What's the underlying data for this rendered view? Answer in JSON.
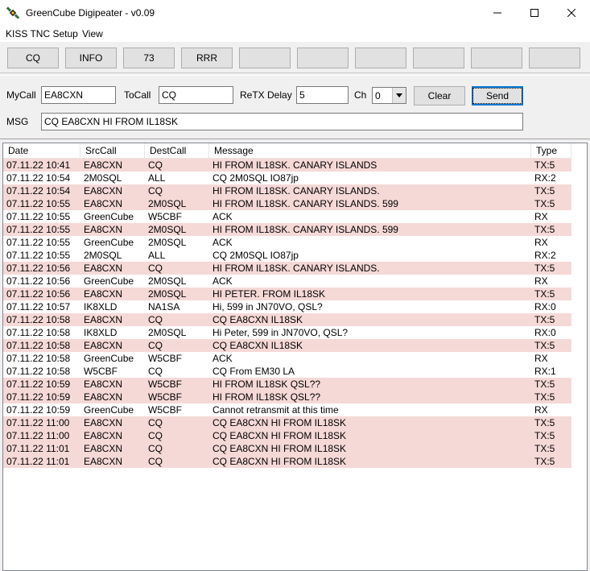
{
  "window": {
    "title": "GreenCube Digipeater - v0.09",
    "icon": "satellite-icon"
  },
  "menu": {
    "items": [
      {
        "label": "KISS TNC Setup"
      },
      {
        "label": "View"
      }
    ]
  },
  "quick_buttons": [
    {
      "label": "CQ"
    },
    {
      "label": "INFO"
    },
    {
      "label": "73"
    },
    {
      "label": "RRR"
    },
    {
      "label": ""
    },
    {
      "label": ""
    },
    {
      "label": ""
    },
    {
      "label": ""
    },
    {
      "label": ""
    },
    {
      "label": ""
    }
  ],
  "form": {
    "mycall_label": "MyCall",
    "mycall_value": "EA8CXN",
    "tocall_label": "ToCall",
    "tocall_value": "CQ",
    "retx_label": "ReTX Delay",
    "retx_value": "5",
    "ch_label": "Ch",
    "ch_value": "0",
    "clear_label": "Clear",
    "send_label": "Send",
    "msg_label": "MSG",
    "msg_value": "CQ EA8CXN HI FROM IL18SK"
  },
  "table": {
    "columns": [
      "Date",
      "SrcCall",
      "DestCall",
      "Message",
      "Type"
    ],
    "rows": [
      {
        "date": "07.11.22 10:41",
        "src": "EA8CXN",
        "dest": "CQ",
        "msg": "HI FROM IL18SK. CANARY ISLANDS",
        "type": "TX:5",
        "tx": true
      },
      {
        "date": "07.11.22 10:54",
        "src": "2M0SQL",
        "dest": "ALL",
        "msg": "CQ 2M0SQL IO87jp",
        "type": "RX:2",
        "tx": false
      },
      {
        "date": "07.11.22 10:54",
        "src": "EA8CXN",
        "dest": "CQ",
        "msg": "HI FROM IL18SK. CANARY ISLANDS.",
        "type": "TX:5",
        "tx": true
      },
      {
        "date": "07.11.22 10:55",
        "src": "EA8CXN",
        "dest": "2M0SQL",
        "msg": "HI FROM IL18SK. CANARY ISLANDS. 599",
        "type": "TX:5",
        "tx": true
      },
      {
        "date": "07.11.22 10:55",
        "src": "GreenCube",
        "dest": "W5CBF",
        "msg": "ACK",
        "type": "RX",
        "tx": false
      },
      {
        "date": "07.11.22 10:55",
        "src": "EA8CXN",
        "dest": "2M0SQL",
        "msg": "HI FROM IL18SK. CANARY ISLANDS. 599",
        "type": "TX:5",
        "tx": true
      },
      {
        "date": "07.11.22 10:55",
        "src": "GreenCube",
        "dest": "2M0SQL",
        "msg": "ACK",
        "type": "RX",
        "tx": false
      },
      {
        "date": "07.11.22 10:55",
        "src": "2M0SQL",
        "dest": "ALL",
        "msg": "CQ 2M0SQL IO87jp",
        "type": "RX:2",
        "tx": false
      },
      {
        "date": "07.11.22 10:56",
        "src": "EA8CXN",
        "dest": "CQ",
        "msg": "HI FROM IL18SK. CANARY ISLANDS.",
        "type": "TX:5",
        "tx": true
      },
      {
        "date": "07.11.22 10:56",
        "src": "GreenCube",
        "dest": "2M0SQL",
        "msg": "ACK",
        "type": "RX",
        "tx": false
      },
      {
        "date": "07.11.22 10:56",
        "src": "EA8CXN",
        "dest": "2M0SQL",
        "msg": "HI PETER. FROM IL18SK",
        "type": "TX:5",
        "tx": true
      },
      {
        "date": "07.11.22 10:57",
        "src": "IK8XLD",
        "dest": "NA1SA",
        "msg": "Hi, 599 in JN70VO, QSL?",
        "type": "RX:0",
        "tx": false
      },
      {
        "date": "07.11.22 10:58",
        "src": "EA8CXN",
        "dest": "CQ",
        "msg": "CQ EA8CXN IL18SK",
        "type": "TX:5",
        "tx": true
      },
      {
        "date": "07.11.22 10:58",
        "src": "IK8XLD",
        "dest": "2M0SQL",
        "msg": "Hi Peter, 599 in JN70VO, QSL?",
        "type": "RX:0",
        "tx": false
      },
      {
        "date": "07.11.22 10:58",
        "src": "EA8CXN",
        "dest": "CQ",
        "msg": "CQ EA8CXN IL18SK",
        "type": "TX:5",
        "tx": true
      },
      {
        "date": "07.11.22 10:58",
        "src": "GreenCube",
        "dest": "W5CBF",
        "msg": "ACK",
        "type": "RX",
        "tx": false
      },
      {
        "date": "07.11.22 10:58",
        "src": "W5CBF",
        "dest": "CQ",
        "msg": "CQ From EM30 LA",
        "type": "RX:1",
        "tx": false
      },
      {
        "date": "07.11.22 10:59",
        "src": "EA8CXN",
        "dest": "W5CBF",
        "msg": "HI FROM IL18SK QSL??",
        "type": "TX:5",
        "tx": true
      },
      {
        "date": "07.11.22 10:59",
        "src": "EA8CXN",
        "dest": "W5CBF",
        "msg": "HI FROM IL18SK QSL??",
        "type": "TX:5",
        "tx": true
      },
      {
        "date": "07.11.22 10:59",
        "src": "GreenCube",
        "dest": "W5CBF",
        "msg": "Cannot retransmit at this time",
        "type": "RX",
        "tx": false
      },
      {
        "date": "07.11.22 11:00",
        "src": "EA8CXN",
        "dest": "CQ",
        "msg": "CQ EA8CXN HI FROM IL18SK",
        "type": "TX:5",
        "tx": true
      },
      {
        "date": "07.11.22 11:00",
        "src": "EA8CXN",
        "dest": "CQ",
        "msg": "CQ EA8CXN HI FROM IL18SK",
        "type": "TX:5",
        "tx": true
      },
      {
        "date": "07.11.22 11:01",
        "src": "EA8CXN",
        "dest": "CQ",
        "msg": "CQ EA8CXN HI FROM IL18SK",
        "type": "TX:5",
        "tx": true
      },
      {
        "date": "07.11.22 11:01",
        "src": "EA8CXN",
        "dest": "CQ",
        "msg": "CQ EA8CXN HI FROM IL18SK",
        "type": "TX:5",
        "tx": true
      }
    ]
  },
  "colors": {
    "tx_row": "#f5d9d7",
    "rx_row": "#ffffff"
  }
}
